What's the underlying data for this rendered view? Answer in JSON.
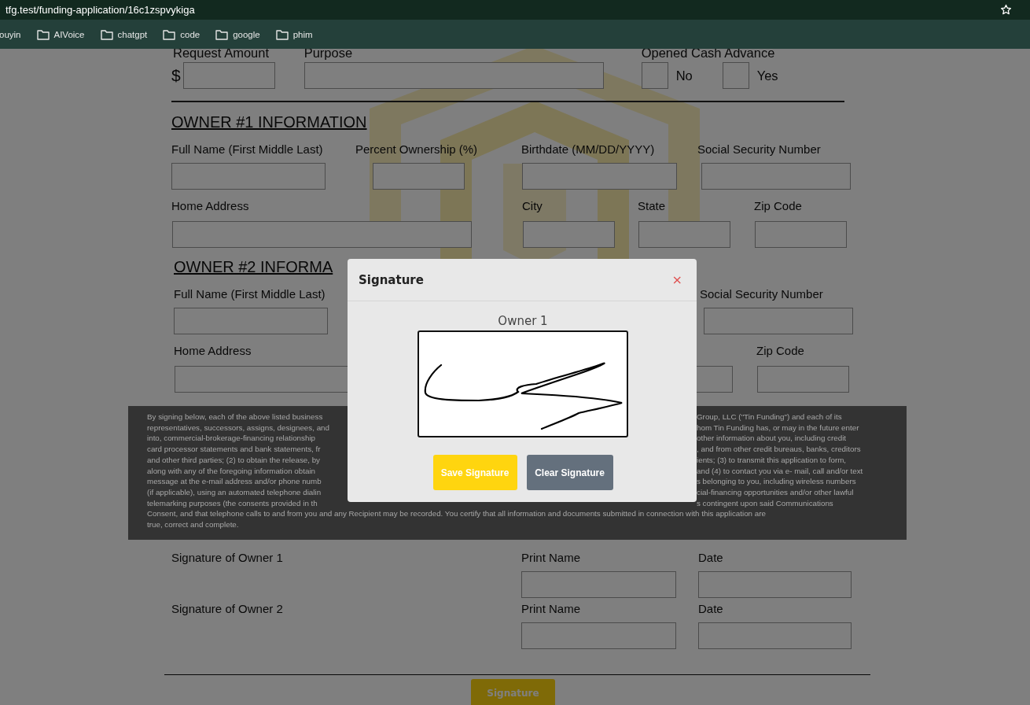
{
  "browser": {
    "url": "tfg.test/funding-application/16c1zspvykiga",
    "bookmarks": [
      {
        "label": "ouyin",
        "kind": "link"
      },
      {
        "label": "AIVoice",
        "kind": "folder"
      },
      {
        "label": "chatgpt",
        "kind": "folder"
      },
      {
        "label": "code",
        "kind": "folder"
      },
      {
        "label": "google",
        "kind": "folder"
      },
      {
        "label": "phim",
        "kind": "folder"
      }
    ]
  },
  "funding": {
    "fields": [
      {
        "label": "Request Amount",
        "prefix": "$"
      },
      {
        "label": "Purpose"
      }
    ],
    "cash_advance": {
      "label": "Opened Cash Advance",
      "options": [
        {
          "label": "No",
          "checked": false
        },
        {
          "label": "Yes",
          "checked": false
        }
      ]
    }
  },
  "owners": [
    {
      "heading": "OWNER #1 INFORMATION",
      "rows": [
        {
          "fields": [
            {
              "kind": "text_input",
              "label": "Full Name (First Middle Last)"
            },
            {
              "kind": "text_input",
              "label": "Percent Ownership (%)"
            },
            {
              "kind": "text_input",
              "label": "Birthdate (MM/DD/YYYY)"
            },
            {
              "kind": "text_input",
              "label": "Social Security Number"
            }
          ]
        },
        {
          "fields": [
            {
              "kind": "text_input",
              "label": "Home Address"
            },
            {
              "kind": "text_input",
              "label": "City"
            },
            {
              "kind": "text_input",
              "label": "State"
            },
            {
              "kind": "text_input",
              "label": "Zip Code"
            }
          ]
        }
      ]
    },
    {
      "heading": "OWNER #2 INFORMA",
      "rows": [
        {
          "fields": [
            {
              "kind": "text_input",
              "label": "Full Name (First Middle Last)"
            },
            {
              "kind": "text_input",
              "label": "Social Security Number"
            }
          ]
        },
        {
          "fields": [
            {
              "kind": "text_input",
              "label": "Home Address"
            },
            {
              "kind": "text_input"
            },
            {
              "kind": "text_input",
              "label": "Zip Code"
            }
          ]
        }
      ]
    }
  ],
  "disclaimer": {
    "lines": [
      {
        "left": "By signing below, each of the above listed business",
        "right": "Group, LLC (\"Tin Funding\") and each of its"
      },
      {
        "left": "representatives, successors, assigns, designees, and",
        "right": "hom Tin Funding has, or may in the future enter"
      },
      {
        "left": "into, commercial-brokerage-financing relationship",
        "right": "other information about you, including credit"
      },
      {
        "left": "card processor statements and bank statements, fr",
        "right": ", and from other credit bureaus, banks, creditors"
      },
      {
        "left": "and other third parties; (2) to obtain the release, by",
        "right": "ients; (3) to transmit this application to form,"
      },
      {
        "left": "along with any of the foregoing information obtain",
        "right": "and (4) to contact you via e- mail, call and/or text"
      },
      {
        "left": "message at the e-mail address and/or phone numb",
        "right": "s belonging to you, including wireless numbers"
      },
      {
        "left": "(if applicable), using an automated telephone dialin",
        "right": "cial-financing opportunities and/or other lawful"
      },
      {
        "left": "telemarking purposes (the consents provided in th",
        "right": "s contingent upon said Communications"
      },
      {
        "full": "Consent, and that telephone calls to and from you and any Recipient may be recorded. You certify that all information and documents submitted in connection with this application are"
      },
      {
        "full": "true, correct and complete."
      }
    ]
  },
  "signatures": [
    {
      "label": "Signature of Owner 1",
      "fields": [
        {
          "label": "Print Name"
        },
        {
          "label": "Date"
        }
      ]
    },
    {
      "label": "Signature of Owner 2",
      "fields": [
        {
          "label": "Print Name"
        },
        {
          "label": "Date"
        }
      ]
    }
  ],
  "submit_button": "Signature",
  "modal": {
    "title": "Signature",
    "close": "×",
    "owner_label": "Owner 1",
    "buttons": [
      {
        "label": "Save Signature",
        "kind": "primary"
      },
      {
        "label": "Clear Signature",
        "kind": "secondary"
      }
    ]
  }
}
